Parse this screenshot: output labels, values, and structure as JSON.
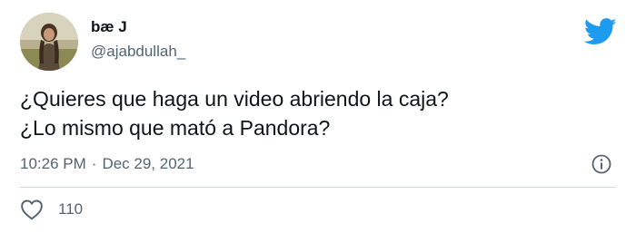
{
  "author": {
    "name": "bæ J",
    "handle": "@ajabdullah_",
    "avatar_icon": "profile-avatar"
  },
  "tweet": {
    "lines": [
      "¿Quieres que haga un video abriendo la caja?",
      "¿Lo mismo que mató a Pandora?"
    ],
    "time": "10:26 PM",
    "separator": "·",
    "date": "Dec 29, 2021"
  },
  "actions": {
    "like_icon": "heart-icon",
    "like_count": "110",
    "info_icon": "info-icon"
  },
  "brand": {
    "logo_icon": "twitter-bird-icon",
    "accent_color": "#1d9bf0",
    "text_color": "#0f1419",
    "muted_color": "#536471"
  }
}
